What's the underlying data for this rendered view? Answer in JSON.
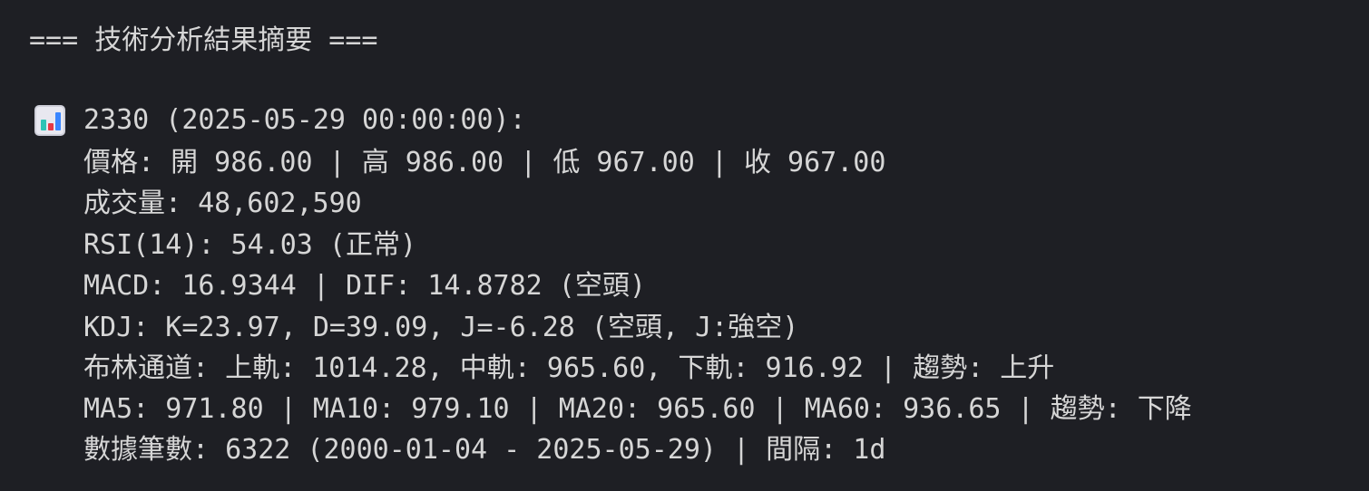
{
  "terminal": {
    "header": "=== 技術分析結果摘要 ===",
    "icon": "bar-chart-icon",
    "title": "2330 (2025-05-29 00:00:00):",
    "lines": [
      "價格: 開 986.00 | 高 986.00 | 低 967.00 | 收 967.00",
      "成交量: 48,602,590",
      "RSI(14): 54.03 (正常)",
      "MACD: 16.9344 | DIF: 14.8782 (空頭)",
      "KDJ: K=23.97, D=39.09, J=-6.28 (空頭, J:強空)",
      "布林通道: 上軌: 1014.28, 中軌: 965.60, 下軌: 916.92 | 趨勢: 上升",
      "MA5: 971.80 | MA10: 979.10 | MA20: 965.60 | MA60: 936.65 | 趨勢: 下降",
      "數據筆數: 6322 (2000-01-04 - 2025-05-29) | 間隔: 1d"
    ],
    "colors": {
      "background": "#1e1f24",
      "text": "#d6d6d6",
      "icon_bars": [
        "#2ec4b6",
        "#e63946",
        "#3a86ff"
      ]
    }
  }
}
